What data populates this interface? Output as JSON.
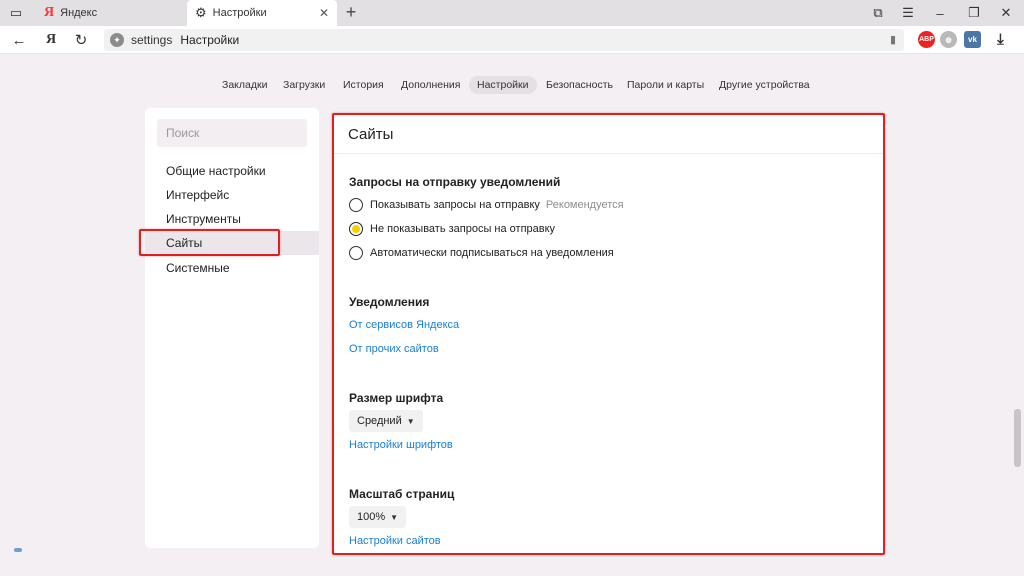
{
  "tabs": [
    {
      "title": "Яндекс",
      "icon": "yandex-logo-icon"
    },
    {
      "title": "Настройки",
      "icon": "gear-icon"
    }
  ],
  "addressbar": {
    "host": "settings",
    "title": "Настройки",
    "logo_letter": "Я"
  },
  "extensions": {
    "abp": "ABP",
    "vk": "vk"
  },
  "section_nav": {
    "items": [
      "Закладки",
      "Загрузки",
      "История",
      "Дополнения",
      "Настройки",
      "Безопасность",
      "Пароли и карты",
      "Другие устройства"
    ],
    "active": "Настройки"
  },
  "sidebar": {
    "search_placeholder": "Поиск",
    "items": [
      "Общие настройки",
      "Интерфейс",
      "Инструменты",
      "Сайты",
      "Системные"
    ],
    "active": "Сайты"
  },
  "main": {
    "title": "Сайты",
    "notification_requests": {
      "heading": "Запросы на отправку уведомлений",
      "options": [
        {
          "label": "Показывать запросы на отправку",
          "hint": "Рекомендуется",
          "checked": false
        },
        {
          "label": "Не показывать запросы на отправку",
          "hint": "",
          "checked": true
        },
        {
          "label": "Автоматически подписываться на уведомления",
          "hint": "",
          "checked": false
        }
      ]
    },
    "notifications": {
      "heading": "Уведомления",
      "links": [
        "От сервисов Яндекса",
        "От прочих сайтов"
      ]
    },
    "font_size": {
      "heading": "Размер шрифта",
      "value": "Средний",
      "link": "Настройки шрифтов"
    },
    "page_zoom": {
      "heading": "Масштаб страниц",
      "value": "100%",
      "link": "Настройки сайтов"
    }
  },
  "colors": {
    "accent_link": "#1a80d4",
    "radio_selected": "#ffcc00",
    "highlight": "#e01f1f"
  }
}
